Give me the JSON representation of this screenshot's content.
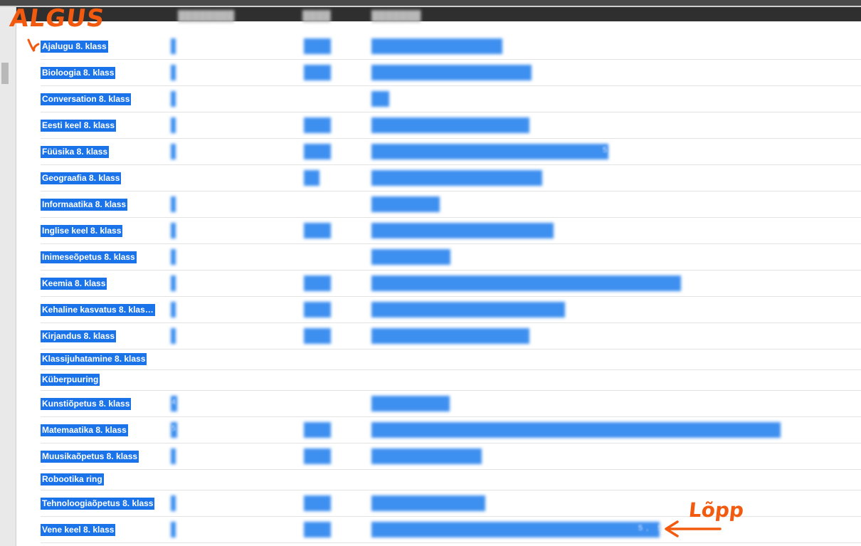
{
  "annotations": {
    "start": "ALGUS",
    "end": "Lõpp"
  },
  "colors": {
    "selection": "#1a73e8",
    "annotation": "#f15a0f"
  },
  "subjects": [
    "Ajalugu 8. klass",
    "Bioloogia 8. klass",
    "Conversation 8. klass",
    "Eesti keel 8. klass",
    "Füüsika 8. klass",
    "Geograafia 8. klass",
    "Informaatika 8. klass",
    "Inglise keel 8. klass",
    "Inimeseõpetus 8. klass",
    "Keemia 8. klass",
    "Kehaline kasvatus 8. klas…",
    "Kirjandus 8. klass",
    "Klassijuhatamine 8. klass",
    "Küberpuuring",
    "Kunstiõpetus 8. klass",
    "Matemaatika 8. klass",
    "Muusikaõpetus 8. klass",
    "Robootika ring",
    "Tehnoloogiaõpetus 8. klass",
    "Vene keel 8. klass"
  ],
  "visible_values": {
    "kunstiopetus_grade": "4",
    "matemaatika_grade": "5",
    "fuusika_tail": "5",
    "vene_keel_tail": "5, 5"
  }
}
